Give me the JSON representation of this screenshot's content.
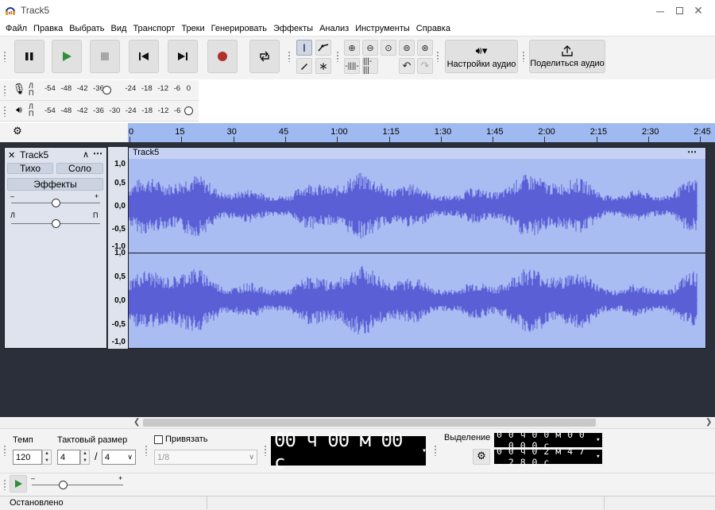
{
  "window": {
    "title": "Track5"
  },
  "menu": [
    "Файл",
    "Правка",
    "Выбрать",
    "Вид",
    "Транспорт",
    "Треки",
    "Генерировать",
    "Эффекты",
    "Анализ",
    "Инструменты",
    "Справка"
  ],
  "toolbar": {
    "audio_setup_label": "Настройки аудио",
    "share_audio_label": "Поделиться аудио"
  },
  "meters": {
    "record": {
      "l": "Л",
      "r": "П",
      "scale": [
        "-54",
        "-48",
        "-42",
        "-36",
        "-24",
        "-18",
        "-12",
        "-6",
        "0"
      ],
      "level": 0.4
    },
    "playback": {
      "l": "Л",
      "r": "П",
      "scale": [
        "-54",
        "-48",
        "-42",
        "-36",
        "-30",
        "-24",
        "-18",
        "-12",
        "-6",
        "0"
      ],
      "level": 1.0
    }
  },
  "ruler": {
    "ticks": [
      "0",
      "15",
      "30",
      "45",
      "1:00",
      "1:15",
      "1:30",
      "1:45",
      "2:00",
      "2:15",
      "2:30",
      "2:45"
    ]
  },
  "track": {
    "name": "Track5",
    "mute_label": "Тихо",
    "solo_label": "Соло",
    "effects_label": "Эффекты",
    "gain_minus": "–",
    "gain_plus": "+",
    "pan_left": "Л",
    "pan_right": "П",
    "gain_level": 0.5,
    "pan_level": 0.5,
    "clip_name": "Track5",
    "scale_labels": [
      "1,0",
      "0,5",
      "0,0",
      "-0,5",
      "-1,0"
    ]
  },
  "bottom": {
    "tempo_label": "Темп",
    "tempo_value": "120",
    "time_sig_label": "Тактовый размер",
    "time_sig_num": "4",
    "time_sig_slash": "/",
    "time_sig_den": "4",
    "snap_label": "Привязать",
    "snap_value": "1/8",
    "time_display": "00 ч 00 м 00 с",
    "selection_label": "Выделение",
    "sel_start": "0 0 ч 0 0 м 0 0 . 0 0 0 с",
    "sel_end": "0 0 ч 0 2 м 4 7 . 2 8 0 с"
  },
  "playbar": {
    "minus": "–",
    "plus": "+",
    "speed_level": 0.34
  },
  "status": {
    "text": "Остановлено"
  },
  "colors": {
    "waveform": "#5a5fd6",
    "clip_bg": "#a9bdf3",
    "ruler": "#9fbaf0",
    "record": "#b0302c",
    "play": "#2f8f3a"
  }
}
